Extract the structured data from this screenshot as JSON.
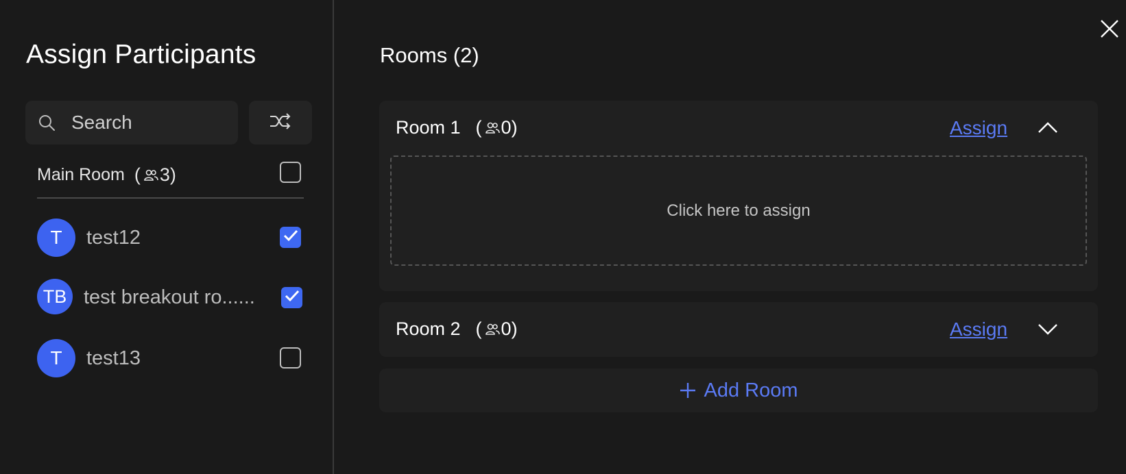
{
  "left_panel": {
    "title": "Assign Participants",
    "search": {
      "placeholder": "Search"
    },
    "main_room": {
      "label": "Main Room",
      "count": "3",
      "checked": false
    },
    "participants": [
      {
        "initials": "T",
        "name": "test12",
        "checked": true
      },
      {
        "initials": "TB",
        "name": "test breakout ro......",
        "checked": true
      },
      {
        "initials": "T",
        "name": "test13",
        "checked": false
      }
    ]
  },
  "right_panel": {
    "title": "Rooms (2)",
    "rooms": [
      {
        "name": "Room 1",
        "count": "0",
        "assign_label": "Assign",
        "expanded": true,
        "drop_text": "Click here to assign"
      },
      {
        "name": "Room 2",
        "count": "0",
        "assign_label": "Assign",
        "expanded": false
      }
    ],
    "add_room_label": "Add Room"
  },
  "colors": {
    "background": "#1a1a1a",
    "card": "#202020",
    "accent": "#3e68f2",
    "link": "#5b7bf5"
  },
  "icons": {
    "search": "search-icon",
    "shuffle": "shuffle-icon",
    "people": "people-icon",
    "check": "check-icon",
    "chevron_up": "chevron-up-icon",
    "chevron_down": "chevron-down-icon",
    "plus": "plus-icon",
    "close": "close-icon"
  }
}
